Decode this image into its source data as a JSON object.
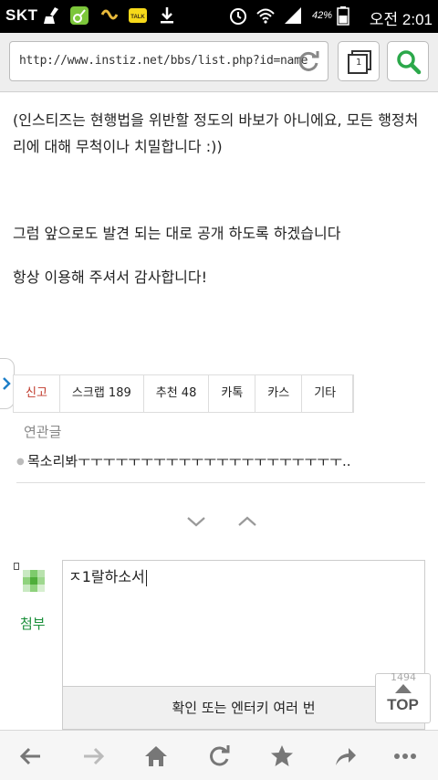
{
  "status_bar": {
    "carrier": "SKT",
    "battery_percent": "42%",
    "time": "오전 2:01",
    "icons": [
      "broom-icon",
      "music-icon",
      "notification-icon",
      "talk-icon",
      "download-icon",
      "alarm-icon",
      "wifi-icon",
      "signal-icon",
      "battery-icon"
    ]
  },
  "address_bar": {
    "url": "http://www.instiz.net/bbs/list.php?id=name",
    "tab_count": "1"
  },
  "article": {
    "paragraph1": "(인스티즈는 현행법을 위반할 정도의 바보가 아니에요, 모든 행정처리에 대해 무척이나 치밀합니다 :))",
    "paragraph2": "그럼 앞으로도 발견 되는 대로 공개 하도록 하겠습니다",
    "paragraph3": "항상 이용해 주셔서 감사합니다!"
  },
  "actions": {
    "report": "신고",
    "scrap": "스크랩 189",
    "recommend": "추천 48",
    "katalk": "카톡",
    "kas": "카스",
    "etc": "기타"
  },
  "related": {
    "title": "연관글",
    "items": [
      "목소리봐ㅜㅜㅜㅜㅜㅜㅜㅜㅜㅜㅜㅜㅜㅜㅜㅜㅜㅜㅜㅜㅜ.."
    ]
  },
  "comment": {
    "attach_label": "첨부",
    "input_value": "ㅈ1랄하소서",
    "submit_label": "확인 또는 엔터키 여러 번"
  },
  "top_button": {
    "label": "TOP",
    "count": "1494"
  },
  "colors": {
    "accent_green": "#1a8f3a",
    "report_red": "#c0392b",
    "side_handle_blue": "#1e7fc8"
  }
}
